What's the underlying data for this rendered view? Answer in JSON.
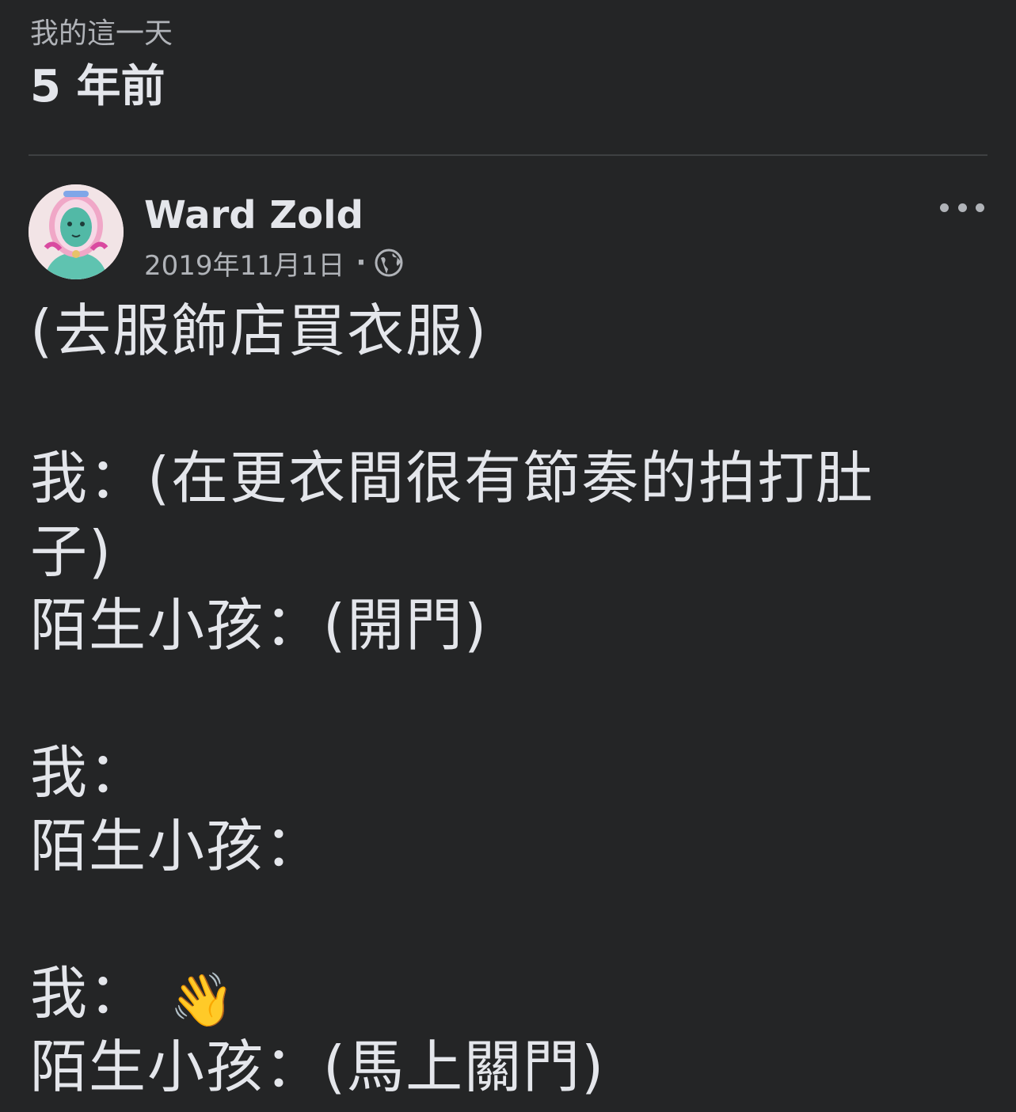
{
  "memory": {
    "kicker": "我的這一天",
    "years_ago": "5 年前"
  },
  "post": {
    "author": "Ward Zold",
    "date": "2019年11月1日",
    "separator": "·",
    "privacy_icon": "globe-icon",
    "more_icon": "more-options-icon",
    "lines": [
      "(去服飾店買衣服)",
      "",
      "我：(在更衣間很有節奏的拍打肚",
      "子)",
      "陌生小孩：(開門)",
      "",
      "我：",
      "陌生小孩：",
      "",
      "我：",
      "陌生小孩：(馬上關門)"
    ],
    "wave_emoji": "👋"
  },
  "colors": {
    "background": "#242526",
    "primary_text": "#e4e6eb",
    "secondary_text": "#b0b3b8",
    "divider": "#3e4042"
  }
}
